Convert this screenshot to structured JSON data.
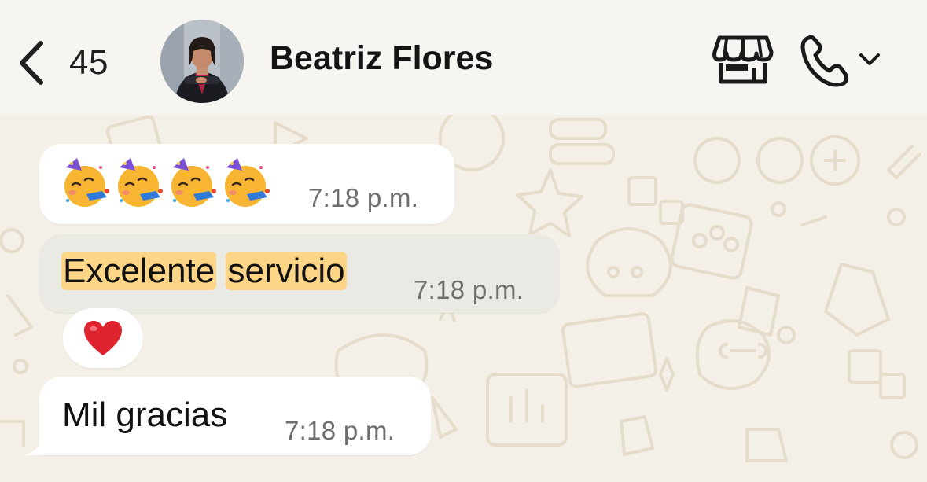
{
  "header": {
    "back_count": "45",
    "contact_name": "Beatriz Flores"
  },
  "messages": [
    {
      "type": "emoji",
      "emojis": [
        "🥳",
        "🥳",
        "🥳",
        "🥳"
      ],
      "time": "7:18 p.m."
    },
    {
      "type": "text",
      "words": [
        "Excelente",
        "servicio"
      ],
      "time": "7:18 p.m.",
      "highlighted": true
    },
    {
      "type": "text",
      "text": "Mil gracias",
      "time": "7:18 p.m."
    }
  ],
  "reaction": {
    "emoji": "❤️"
  },
  "colors": {
    "header_bg": "#f6f5f2",
    "chat_bg": "#f4f0e7",
    "bubble_bg": "#ffffff",
    "selected_bubble_bg": "#ebe9e4",
    "highlight": "#fcd586",
    "heart": "#e0242f"
  },
  "icons": [
    "chevron-left-icon",
    "store-icon",
    "phone-icon",
    "chevron-down-icon",
    "heart-icon",
    "party-face-icon"
  ]
}
